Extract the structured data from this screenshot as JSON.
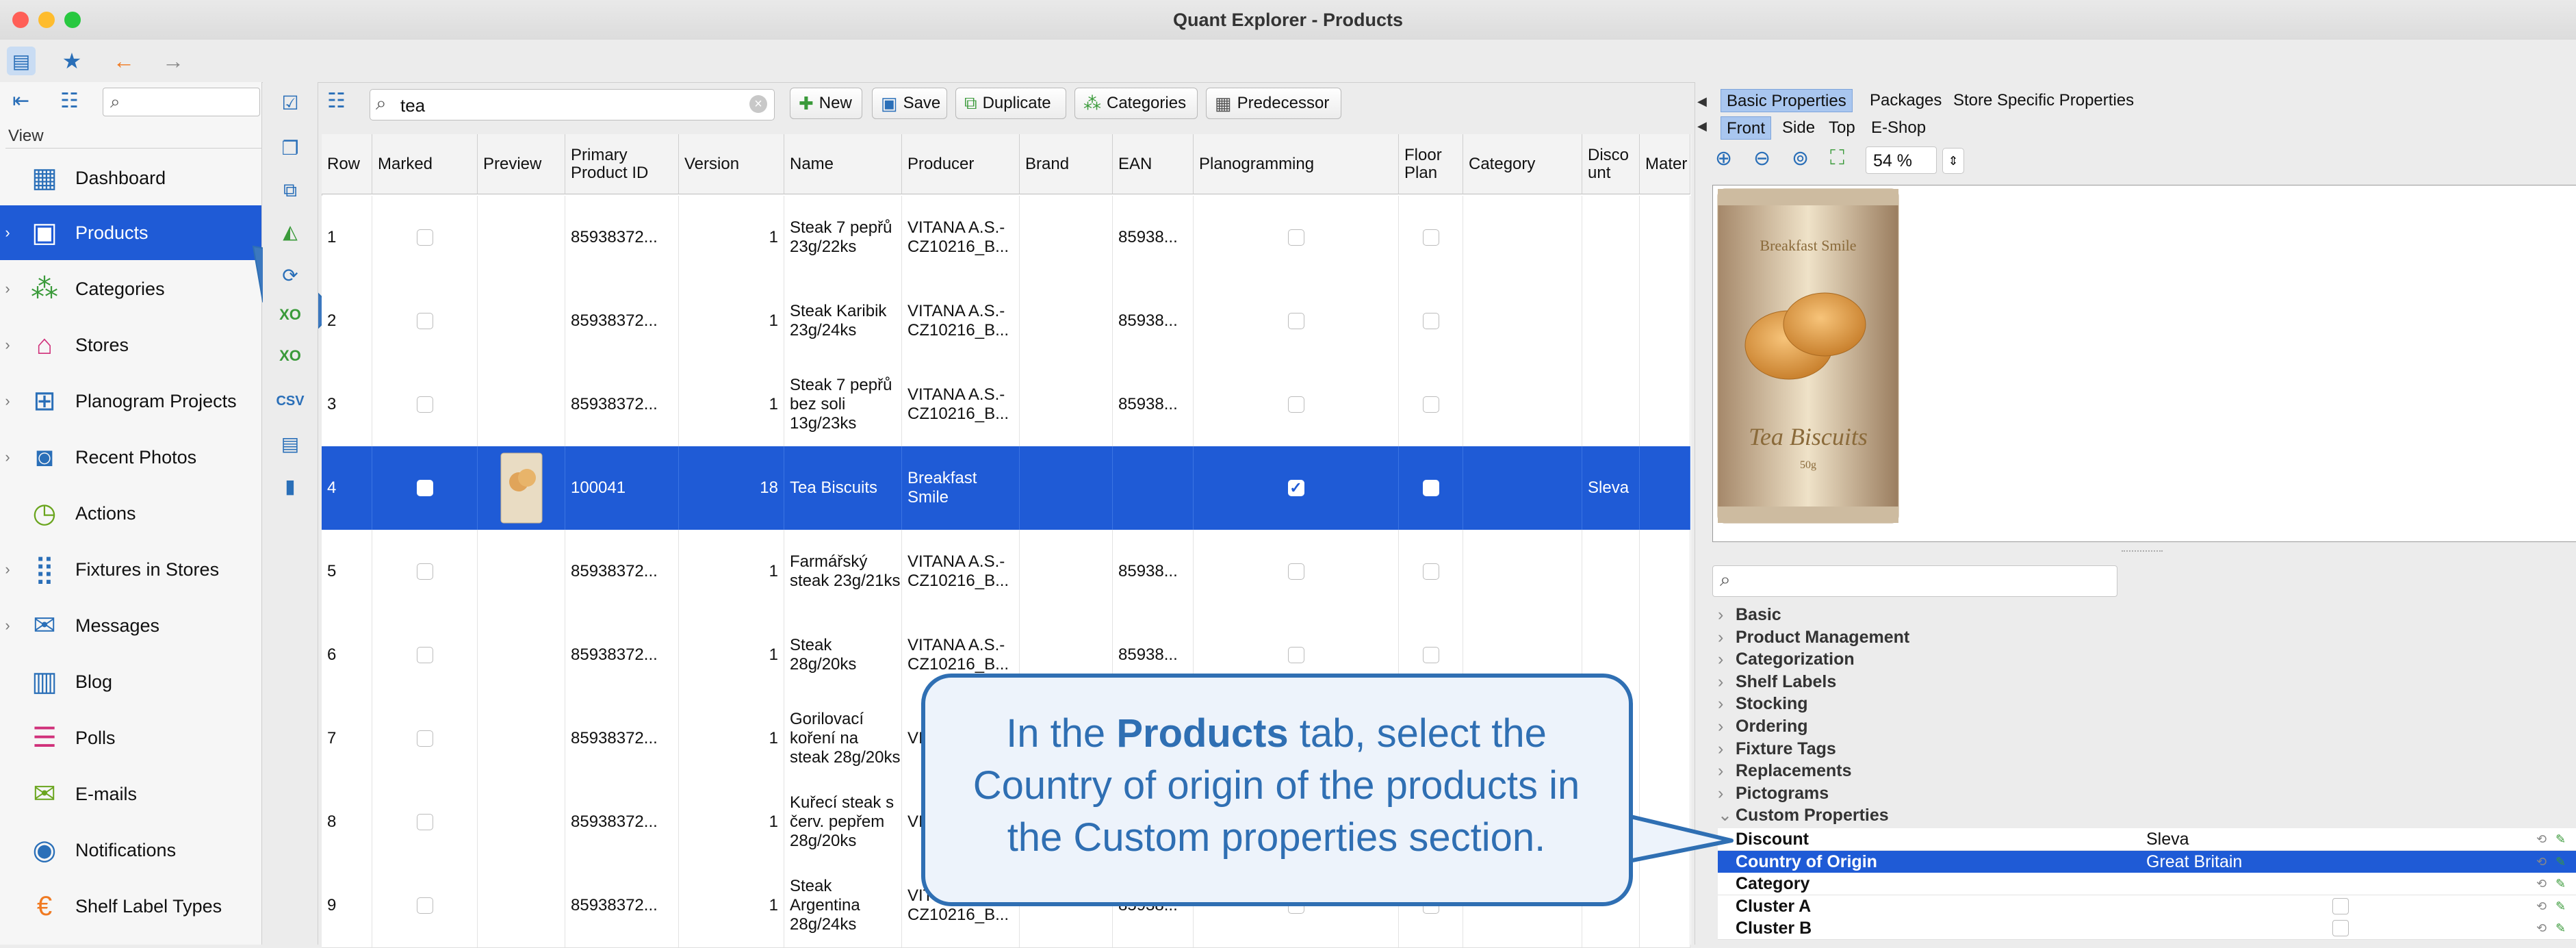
{
  "window": {
    "title": "Quant Explorer - Products"
  },
  "colors": {
    "accent": "#1f5bd6",
    "callout": "#2f6fb3",
    "close": "#ff5f57",
    "minimize": "#febc2e",
    "zoom": "#28c840"
  },
  "sidebar": {
    "view_label": "View",
    "items": [
      {
        "label": "Dashboard",
        "icon": "dashboard-icon"
      },
      {
        "label": "Products",
        "icon": "products-icon"
      },
      {
        "label": "Categories",
        "icon": "categories-icon"
      },
      {
        "label": "Stores",
        "icon": "store-icon"
      },
      {
        "label": "Planogram Projects",
        "icon": "planogram-icon"
      },
      {
        "label": "Recent Photos",
        "icon": "camera-icon"
      },
      {
        "label": "Actions",
        "icon": "clock-icon"
      },
      {
        "label": "Fixtures in Stores",
        "icon": "grid-icon"
      },
      {
        "label": "Messages",
        "icon": "message-icon"
      },
      {
        "label": "Blog",
        "icon": "blog-icon"
      },
      {
        "label": "Polls",
        "icon": "poll-icon"
      },
      {
        "label": "E-mails",
        "icon": "mail-icon"
      },
      {
        "label": "Notifications",
        "icon": "bell-icon"
      },
      {
        "label": "Shelf Label Types",
        "icon": "label-icon"
      }
    ]
  },
  "main": {
    "search": {
      "value": "tea"
    },
    "buttons": {
      "new": "New",
      "save": "Save",
      "duplicate": "Duplicate",
      "categories": "Categories",
      "predecessor": "Predecessor"
    },
    "columns": [
      "Row",
      "Marked",
      "Preview",
      "Primary Product ID",
      "Version",
      "Name",
      "Producer",
      "Brand",
      "EAN",
      "Planogramming",
      "Floor Plan",
      "Category",
      "Disco unt",
      "Mater"
    ],
    "rows": [
      {
        "row": "1",
        "id": "85938372...",
        "version": "1",
        "name": "Steak 7 pepřů 23g/22ks",
        "producer": "VITANA A.S.- CZ10216_B...",
        "ean": "85938..."
      },
      {
        "row": "2",
        "id": "85938372...",
        "version": "1",
        "name": "Steak Karibik 23g/24ks",
        "producer": "VITANA A.S.- CZ10216_B...",
        "ean": "85938..."
      },
      {
        "row": "3",
        "id": "85938372...",
        "version": "1",
        "name": "Steak 7 pepřů bez soli 13g/23ks",
        "producer": "VITANA A.S.- CZ10216_B...",
        "ean": "85938..."
      },
      {
        "row": "4",
        "id": "100041",
        "version": "18",
        "name": "Tea Biscuits",
        "producer": "Breakfast Smile",
        "ean": "",
        "discount": "Sleva"
      },
      {
        "row": "5",
        "id": "85938372...",
        "version": "1",
        "name": "Farmářský steak 23g/21ks",
        "producer": "VITANA A.S.- CZ10216_B...",
        "ean": "85938..."
      },
      {
        "row": "6",
        "id": "85938372...",
        "version": "1",
        "name": "Steak 28g/20ks",
        "producer": "VITANA A.S.- CZ10216_B...",
        "ean": "85938..."
      },
      {
        "row": "7",
        "id": "85938372...",
        "version": "1",
        "name": "Gorilovací koření na steak 28g/20ks",
        "producer": "VI",
        "ean": ""
      },
      {
        "row": "8",
        "id": "85938372...",
        "version": "1",
        "name": "Kuřecí steak s červ. pepřem 28g/20ks",
        "producer": "VI CZ",
        "ean": ""
      },
      {
        "row": "9",
        "id": "85938372...",
        "version": "1",
        "name": "Steak Argentina 28g/24ks",
        "producer": "VIT CZ10216_B...",
        "ean": "85938..."
      }
    ]
  },
  "right_panel": {
    "tabs": [
      "Basic Properties",
      "Packages",
      "Store Specific Properties"
    ],
    "view_tabs": [
      "Front",
      "Side",
      "Top",
      "E-Shop"
    ],
    "zoom": "54 %",
    "package": {
      "brand": "Breakfast Smile",
      "name": "Tea Biscuits",
      "weight": "50g"
    },
    "sections": [
      "Basic",
      "Product Management",
      "Categorization",
      "Shelf Labels",
      "Stocking",
      "Ordering",
      "Fixture Tags",
      "Replacements",
      "Pictograms",
      "Custom Properties"
    ],
    "custom_props": [
      {
        "key": "Discount",
        "value": "Sleva"
      },
      {
        "key": "Country of Origin",
        "value": "Great Britain"
      },
      {
        "key": "Category",
        "value": ""
      },
      {
        "key": "Cluster A",
        "value": ""
      },
      {
        "key": "Cluster B",
        "value": ""
      }
    ]
  },
  "callout": {
    "before": "In the ",
    "bold": "Products",
    "after": " tab, select the Country of origin of the products in the Custom properties section."
  }
}
